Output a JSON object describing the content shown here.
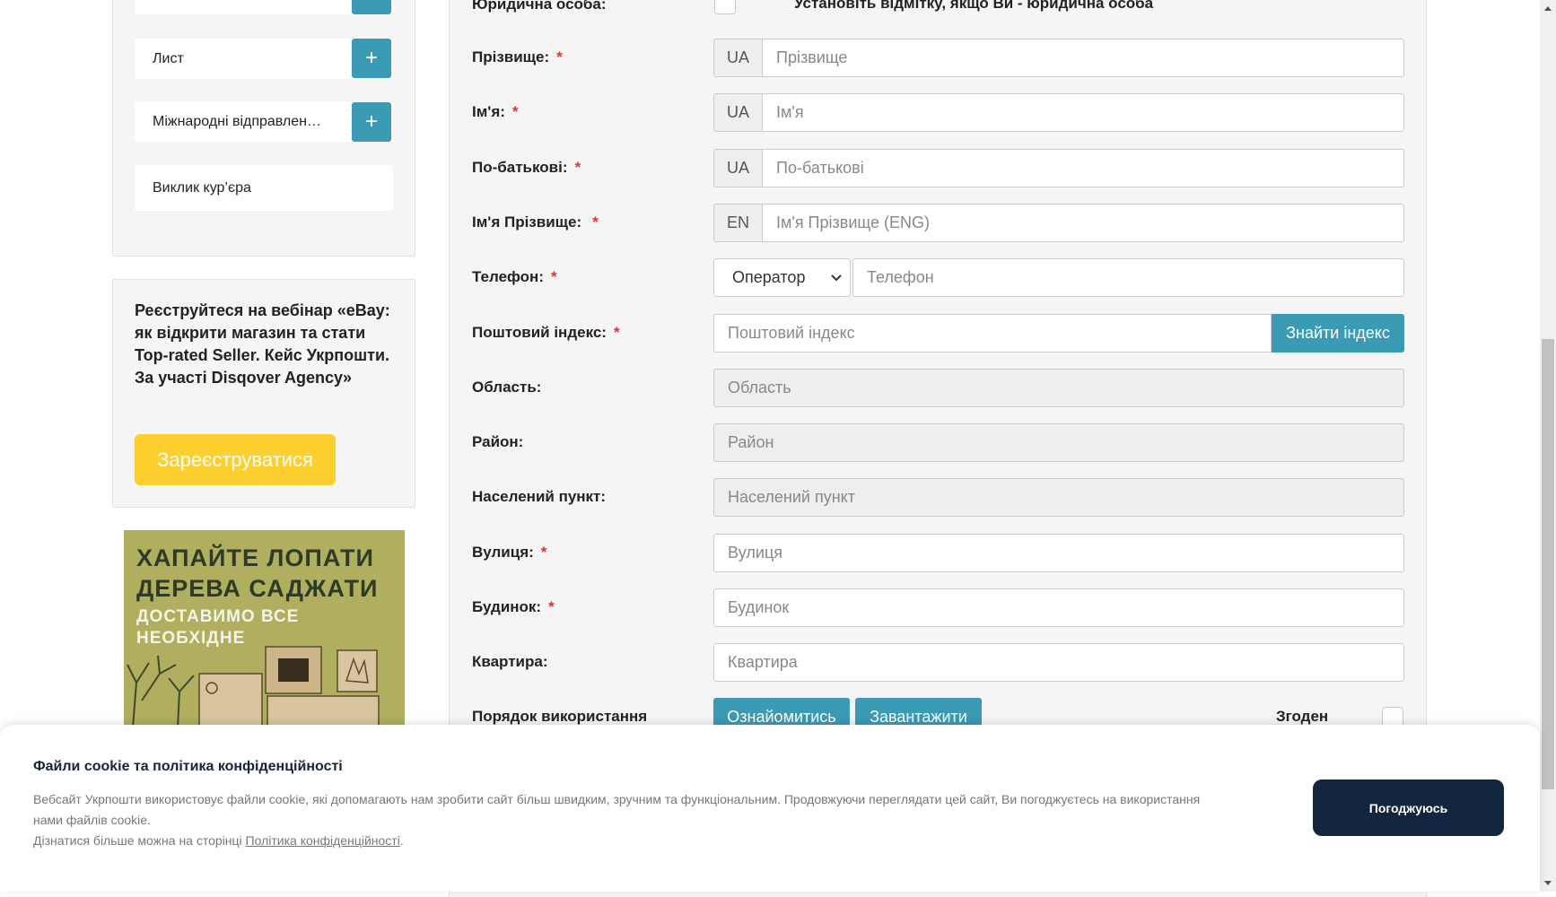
{
  "sidebar": {
    "menu": [
      {
        "label": "Лист"
      },
      {
        "label": "Міжнародні відправлен…"
      },
      {
        "label": "Виклик кур’єра"
      }
    ],
    "plus_glyph": "+",
    "webinar": {
      "text": "Реєструйтеся на вебінар «eBay: як відкрити магазин та стати Top-rated Seller. Кейс Укрпошти. За участі Disqover Agency»",
      "button_label": "Зареєструватися"
    },
    "banner": {
      "line1": "ХАПАЙТЕ ЛОПАТИ",
      "line2": "ДЕРЕВА САДЖАТИ",
      "line3": "ДОСТАВИМО ВСЕ",
      "line4": "НЕОБХІДНЕ"
    }
  },
  "form": {
    "legal": {
      "label": "Юридична особа:",
      "hint": "Установіть відмітку, якщо Ви - юридична особа"
    },
    "surname": {
      "label": "Прізвище:",
      "prefix": "UA",
      "placeholder": "Прізвище"
    },
    "name": {
      "label": "Ім'я:",
      "prefix": "UA",
      "placeholder": "Ім'я"
    },
    "patronymic": {
      "label": "По-батькові:",
      "prefix": "UA",
      "placeholder": "По-батькові"
    },
    "fullname_en": {
      "label": "Ім'я Прізвище:",
      "prefix": "EN",
      "placeholder": "Ім'я Прізвище (ENG)"
    },
    "phone": {
      "label": "Телефон:",
      "operator": "Оператор",
      "placeholder": "Телефон"
    },
    "postcode": {
      "label": "Поштовий індекс:",
      "placeholder": "Поштовий індекс",
      "button": "Знайти індекс"
    },
    "region": {
      "label": "Область:",
      "placeholder": "Область"
    },
    "district": {
      "label": "Район:",
      "placeholder": "Район"
    },
    "city": {
      "label": "Населений пункт:",
      "placeholder": "Населений пункт"
    },
    "street": {
      "label": "Вулиця:",
      "placeholder": "Вулиця"
    },
    "house": {
      "label": "Будинок:",
      "placeholder": "Будинок"
    },
    "apartment": {
      "label": "Квартира:",
      "placeholder": "Квартира"
    },
    "terms": {
      "label": "Порядок використання",
      "view_button": "Ознайомитись",
      "download_button": "Завантажити",
      "agree_label": "Згоден"
    },
    "required_mark": "*"
  },
  "cookie": {
    "title": "Файли cookie та політика конфіденційності",
    "text1": "Вебсайт Укрпошти використовує файли cookie, які допомагають нам зробити сайт більш швидким, зручним та функціональним. Продовжуючи переглядати цей сайт, Ви погоджуєтесь на використання нами файлів cookie.",
    "text2_prefix": "Дізнатися більше можна на сторінці ",
    "link": "Політика конфіденційності",
    "text2_suffix": ".",
    "button": "Погоджуюсь"
  },
  "colors": {
    "accent": "#3b9ab4",
    "yellow": "#fdd02f",
    "dark_button": "#12263d",
    "required": "#e0322f"
  }
}
